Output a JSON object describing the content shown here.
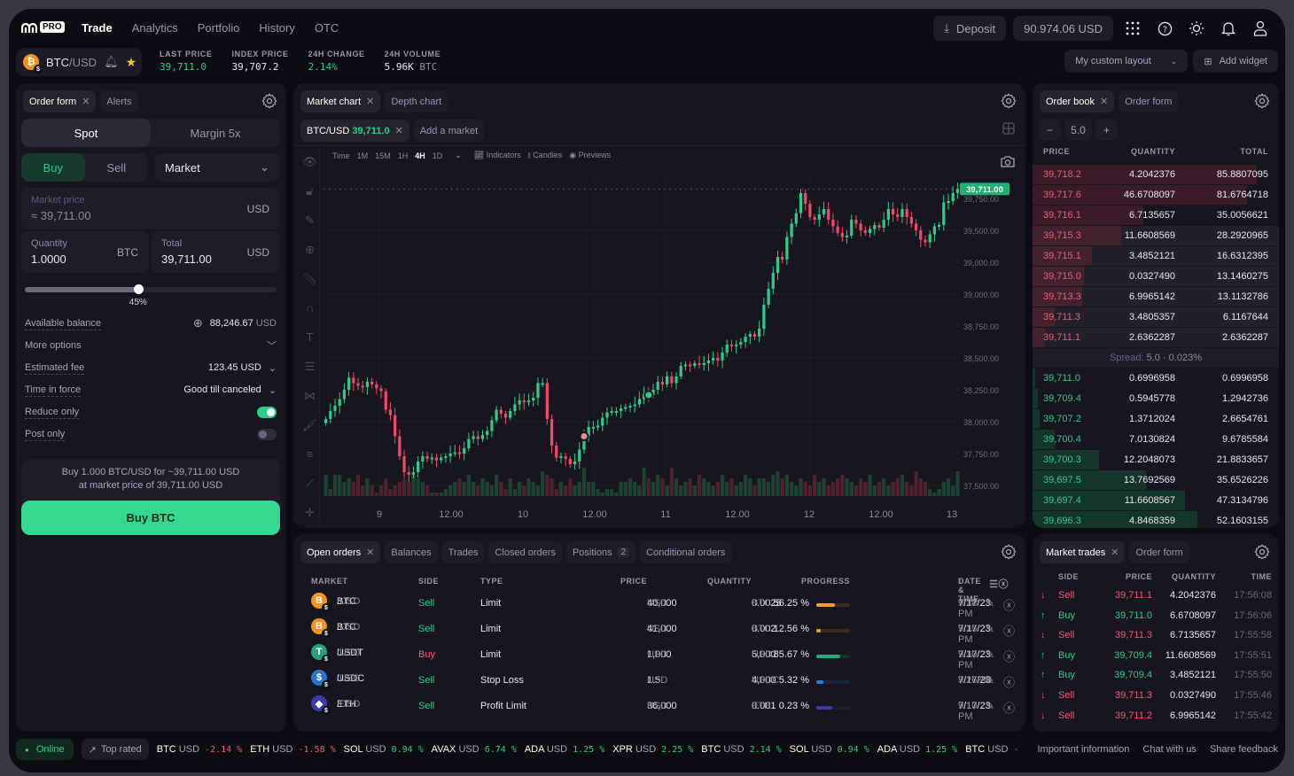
{
  "nav": {
    "logo_badge": "PRO",
    "links": [
      "Trade",
      "Analytics",
      "Portfolio",
      "History",
      "OTC"
    ],
    "active": "Trade",
    "deposit_label": "Deposit",
    "balance": "90.974.06 USD",
    "icons": [
      "apps-grid-icon",
      "help-icon",
      "theme-sun-icon",
      "bell-icon",
      "user-icon"
    ]
  },
  "ticker": {
    "pair_base": "BTC",
    "pair_quote": "/USD",
    "stats": [
      {
        "label": "LAST PRICE",
        "value": "39,711.0",
        "unit": "",
        "color": "#2ecc87"
      },
      {
        "label": "INDEX PRICE",
        "value": "39,707.2",
        "unit": "",
        "color": "#e8e6ee"
      },
      {
        "label": "24H CHANGE",
        "value": "2.14%",
        "unit": "",
        "color": "#2ecc87"
      },
      {
        "label": "24H VOLUME",
        "value": "5.96K",
        "unit": "BTC",
        "color": "#e8e6ee"
      }
    ],
    "layout_select": "My custom layout",
    "add_widget_label": "Add widget"
  },
  "order_form": {
    "tabs": [
      "Order form",
      "Alerts"
    ],
    "mode_tabs": [
      "Spot",
      "Margin 5x"
    ],
    "side_tabs": [
      "Buy",
      "Sell"
    ],
    "order_type": "Market",
    "market_price_label": "Market price",
    "market_price_value": "≈ 39,711.00",
    "market_price_unit": "USD",
    "quantity_label": "Quantity",
    "quantity_value": "1.0000",
    "quantity_unit": "BTC",
    "total_label": "Total",
    "total_value": "39,711.00",
    "total_unit": "USD",
    "slider_percent": 45,
    "slider_label": "45%",
    "available_balance_label": "Available balance",
    "available_balance_value": "88,246.67",
    "available_balance_unit": "USD",
    "more_options_label": "More options",
    "estimated_fee_label": "Estimated fee",
    "estimated_fee_value": "123.45 USD",
    "time_in_force_label": "Time in force",
    "time_in_force_value": "Good till canceled",
    "reduce_only_label": "Reduce only",
    "reduce_only_on": true,
    "post_only_label": "Post only",
    "post_only_on": false,
    "summary_line1": "Buy 1.000 BTC/USD for ~39,711.00 USD",
    "summary_line2": "at market price of 39,711.00 USD",
    "submit_label": "Buy BTC"
  },
  "chart_panel": {
    "tabs": [
      "Market chart",
      "Depth chart"
    ],
    "market_tab_pair": "BTC/USD",
    "market_tab_price": "39,711.0",
    "add_market_label": "Add a market",
    "time_label": "Time",
    "intervals": [
      "1M",
      "15M",
      "1H",
      "4H",
      "1D"
    ],
    "active_interval": "4H",
    "indicators_label": "Indicators",
    "candles_label": "Candles",
    "previews_label": "Previews",
    "tool_icons": [
      "eye-icon",
      "lock-icon",
      "pencil-lock-icon",
      "zoom-in-icon",
      "ruler-icon",
      "magnet-icon",
      "text-icon",
      "fib-icon",
      "pattern-icon",
      "brush-icon",
      "lines-icon",
      "trendline-icon",
      "crosshair-icon"
    ]
  },
  "chart_data": {
    "type": "candlestick",
    "title": "BTC/USD 4H",
    "y_tick_labels": [
      "39,750.00",
      "39,500.00",
      "39,000.00",
      "39,000.00",
      "38,750.00",
      "38,500.00",
      "38,250.00",
      "38,000.00",
      "37,750.00",
      "37,500.00"
    ],
    "x_tick_labels": [
      "9",
      "12.00",
      "10",
      "12.00",
      "11",
      "12.00",
      "12",
      "12.00",
      "13"
    ],
    "ylim": [
      37400,
      39800
    ],
    "last_price": 39711.0,
    "last_price_label": "39,711.00",
    "close_series": [
      37980,
      38040,
      38080,
      38130,
      38200,
      38290,
      38250,
      38230,
      38220,
      38260,
      38240,
      38210,
      38190,
      38050,
      38010,
      37850,
      37700,
      37580,
      37560,
      37580,
      37660,
      37700,
      37680,
      37690,
      37670,
      37690,
      37700,
      37720,
      37730,
      37720,
      37760,
      37830,
      37850,
      37830,
      37860,
      37890,
      37970,
      38050,
      38020,
      37990,
      38040,
      38090,
      38120,
      38110,
      38120,
      38140,
      38250,
      38250,
      37980,
      37780,
      37690,
      37700,
      37680,
      37640,
      37660,
      37750,
      37850,
      37920,
      37920,
      37930,
      37990,
      38030,
      38040,
      38040,
      38060,
      38070,
      38080,
      38090,
      38130,
      38170,
      38160,
      38200,
      38260,
      38240,
      38300,
      38250,
      38300,
      38380,
      38390,
      38380,
      38400,
      38390,
      38400,
      38420,
      38440,
      38420,
      38480,
      38540,
      38530,
      38540,
      38560,
      38600,
      38620,
      38600,
      38660,
      38840,
      38960,
      39080,
      39200,
      39180,
      39350,
      39450,
      39530,
      39680,
      39600,
      39500,
      39480,
      39520,
      39560,
      39480,
      39430,
      39380,
      39350,
      39360,
      39480,
      39450,
      39400,
      39380,
      39410,
      39440,
      39420,
      39480,
      39560,
      39520,
      39500,
      39560,
      39500,
      39450,
      39400,
      39330,
      39310,
      39370,
      39430,
      39440,
      39610,
      39620,
      39680,
      39711
    ],
    "volume_levels": [
      0.6,
      0.2,
      0.6,
      0.6,
      0.4,
      0.5,
      0.4,
      0.6,
      0.3,
      0.5,
      0.3,
      0.1,
      0.3,
      0.5,
      0.2,
      0.3,
      0.4,
      0.5,
      0.4,
      0.6,
      0.5,
      0.4,
      0.3,
      0.1,
      0.1,
      0.1,
      0.2,
      0.3,
      0.4,
      0.5,
      0.4,
      0.6,
      0.4,
      0.3,
      0.5,
      0.4,
      0.3,
      0.6,
      0.4,
      0.2,
      0.5,
      0.2,
      0.4,
      0.3,
      0.5,
      0.4,
      0.3,
      0.7,
      0.6,
      0.5,
      0.2,
      0.4,
      0.3,
      0.5,
      0.3,
      0.4,
      0.8,
      0.4,
      0.4,
      0.2,
      0.1,
      0.2,
      0.2,
      0.1,
      0.4,
      0.4,
      0.5,
      0.4,
      0.3,
      0.8,
      0.5,
      0.4,
      0.6,
      0.5,
      0.3,
      0.8,
      0.5,
      0.3,
      0.4,
      0.5,
      0.3,
      0.6,
      0.5,
      0.4,
      0.3,
      0.4,
      0.6,
      0.4,
      0.5,
      0.3,
      0.4,
      0.6,
      0.5,
      0.3,
      0.5,
      0.5,
      0.4,
      0.6,
      0.7,
      0.5,
      0.6,
      0.4,
      0.3,
      0.5,
      0.4,
      0.3,
      0.6,
      0.4,
      0.5,
      0.3,
      0.4,
      0.5,
      0.6,
      0.5,
      0.4,
      0.3,
      0.5,
      0.4,
      0.6,
      0.3,
      0.4,
      0.5,
      0.3,
      0.4,
      0.5,
      0.6,
      0.4,
      0.3,
      0.7,
      0.5,
      0.4,
      0.2,
      0.1,
      0.2,
      0.4,
      0.5,
      0.3,
      0.7
    ],
    "markers": [
      {
        "type": "sell",
        "index": 56,
        "color": "#f58a9a"
      },
      {
        "type": "buy",
        "index": 70,
        "color": "#2ecc87"
      }
    ]
  },
  "order_book": {
    "tabs": [
      "Order book",
      "Order form"
    ],
    "step_value": "5.0",
    "headers": [
      "PRICE",
      "QUANTITY",
      "TOTAL"
    ],
    "asks": [
      {
        "price": "39,718.2",
        "qty": "4.2042376",
        "total": "85.8807095",
        "depth": 0.91
      },
      {
        "price": "39,717.6",
        "qty": "46.6708097",
        "total": "81.6764718",
        "depth": 0.87
      },
      {
        "price": "39,716.1",
        "qty": "6.7135657",
        "total": "35.0056621",
        "depth": 0.45
      },
      {
        "price": "39,715.3",
        "qty": "11.6608569",
        "total": "28.2920965",
        "depth": 0.36
      },
      {
        "price": "39,715.1",
        "qty": "3.4852121",
        "total": "16.6312395",
        "depth": 0.24
      },
      {
        "price": "39,715.0",
        "qty": "0.0327490",
        "total": "13.1460275",
        "depth": 0.21
      },
      {
        "price": "39,713.3",
        "qty": "6.9965142",
        "total": "13.1132786",
        "depth": 0.2
      },
      {
        "price": "39,711.3",
        "qty": "3.4805357",
        "total": "6.1167644",
        "depth": 0.09
      },
      {
        "price": "39,711.1",
        "qty": "2.6362287",
        "total": "2.6362287",
        "depth": 0.05
      }
    ],
    "spread_label": "Spread:",
    "spread_value": "5.0 · 0.023%",
    "bids": [
      {
        "price": "39,711.0",
        "qty": "0.6996958",
        "total": "0.6996958",
        "depth": 0.01
      },
      {
        "price": "39,709.4",
        "qty": "0.5945778",
        "total": "1.2942736",
        "depth": 0.02
      },
      {
        "price": "39,707.2",
        "qty": "1.3712024",
        "total": "2.6654761",
        "depth": 0.03
      },
      {
        "price": "39,700.4",
        "qty": "7.0130824",
        "total": "9.6785584",
        "depth": 0.09
      },
      {
        "price": "39,700.3",
        "qty": "12.2048073",
        "total": "21.8833657",
        "depth": 0.27
      },
      {
        "price": "39,697.5",
        "qty": "13.7692569",
        "total": "35.6526226",
        "depth": 0.46
      },
      {
        "price": "39,697.4",
        "qty": "11.6608567",
        "total": "47.3134796",
        "depth": 0.62
      },
      {
        "price": "39,696.3",
        "qty": "4.8468359",
        "total": "52.1603155",
        "depth": 0.67
      }
    ]
  },
  "orders": {
    "tabs": [
      {
        "label": "Open orders",
        "closable": true,
        "active": true
      },
      {
        "label": "Balances"
      },
      {
        "label": "Trades"
      },
      {
        "label": "Closed orders"
      },
      {
        "label": "Positions",
        "badge": "2"
      },
      {
        "label": "Conditional orders"
      }
    ],
    "headers": [
      "MARKET",
      "SIDE",
      "TYPE",
      "PRICE",
      "QUANTITY",
      "PROGRESS",
      "DATE & TIME"
    ],
    "rows": [
      {
        "coin": "B",
        "coin_color": "#f7931a",
        "base": "BTC",
        "quote": "/USD",
        "side": "Sell",
        "type": "Limit",
        "price": "40,000",
        "price_unit": "USD",
        "qty": "0.0025",
        "qty_unit": "BTC",
        "progress_label": "56.25 %",
        "progress": 56.25,
        "bar_color": "#f7a21a",
        "track_color": "#3d2c17",
        "date": "7/17/23",
        "time": "9:38 PM"
      },
      {
        "coin": "B",
        "coin_color": "#f7931a",
        "base": "BTC",
        "quote": "/USD",
        "side": "Sell",
        "type": "Limit",
        "price": "41,000",
        "price_unit": "USD",
        "qty": "0.002",
        "qty_unit": "BTC",
        "progress_label": "12.56 %",
        "progress": 12.56,
        "bar_color": "#f7a21a",
        "track_color": "#3d2c17",
        "date": "7/17/23",
        "time": "9:35 PM"
      },
      {
        "coin": "T",
        "coin_color": "#26a17b",
        "base": "USDT",
        "quote": "/USD",
        "side": "Buy",
        "type": "Limit",
        "price": "1,000",
        "price_unit": "USD",
        "qty": "5,000",
        "qty_unit": "USDT",
        "progress_label": "85.67 %",
        "progress": 70,
        "bar_color": "#2ba77f",
        "track_color": "#17302a",
        "date": "7/17/23",
        "time": "9:30 PM"
      },
      {
        "coin": "$",
        "coin_color": "#2775ca",
        "base": "USDC",
        "quote": "/USD",
        "side": "Sell",
        "type": "Stop Loss",
        "price": "1.5",
        "price_unit": "USD",
        "qty": "4,000",
        "qty_unit": "USDC",
        "progress_label": "5.32 %",
        "progress": 22,
        "bar_color": "#2f7fd8",
        "track_color": "#17263b",
        "date": "7/17/23",
        "time": "9:26PM"
      },
      {
        "coin": "◆",
        "coin_color": "#3c3ca8",
        "base": "ETH",
        "quote": "/USD",
        "side": "Sell",
        "type": "Profit Limit",
        "price": "36,000",
        "price_unit": "USD",
        "qty": "0.001",
        "qty_unit": "ETH",
        "progress_label": "0.23 %",
        "progress": 47,
        "bar_color": "#3a3ab0",
        "track_color": "#1d1d3a",
        "date": "7/17/23",
        "time": "9:10 PM"
      }
    ]
  },
  "market_trades": {
    "tabs": [
      "Market trades",
      "Order form"
    ],
    "headers": [
      "SIDE",
      "PRICE",
      "QUANTITY",
      "TIME"
    ],
    "rows": [
      {
        "side": "Sell",
        "price": "39,711.1",
        "qty": "4.2042376",
        "time": "17:56:08"
      },
      {
        "side": "Buy",
        "price": "39,711.0",
        "qty": "6.6708097",
        "time": "17:56:06"
      },
      {
        "side": "Sell",
        "price": "39,711.3",
        "qty": "6.7135657",
        "time": "17:55:58"
      },
      {
        "side": "Buy",
        "price": "39,709.4",
        "qty": "11.6608569",
        "time": "17:55:51"
      },
      {
        "side": "Buy",
        "price": "39,709.4",
        "qty": "3.4852121",
        "time": "17:55:50"
      },
      {
        "side": "Sell",
        "price": "39,711.3",
        "qty": "0.0327490",
        "time": "17:55:46"
      },
      {
        "side": "Sell",
        "price": "39,711.2",
        "qty": "6.9965142",
        "time": "17:55:42"
      }
    ]
  },
  "footer": {
    "status": "Online",
    "top_rated": "Top rated",
    "tickers": [
      {
        "base": "BTC",
        "quote": "USD",
        "change": "-2.14 %",
        "dir": "down"
      },
      {
        "base": "ETH",
        "quote": "USD",
        "change": "-1.58 %",
        "dir": "down"
      },
      {
        "base": "SOL",
        "quote": "USD",
        "change": "0.94 %",
        "dir": "up"
      },
      {
        "base": "AVAX",
        "quote": "USD",
        "change": "6.74 %",
        "dir": "up"
      },
      {
        "base": "ADA",
        "quote": "USD",
        "change": "1.25 %",
        "dir": "up"
      },
      {
        "base": "XPR",
        "quote": "USD",
        "change": "2.25 %",
        "dir": "up"
      },
      {
        "base": "BTC",
        "quote": "USD",
        "change": "2.14 %",
        "dir": "up"
      },
      {
        "base": "SOL",
        "quote": "USD",
        "change": "0.94 %",
        "dir": "up"
      },
      {
        "base": "ADA",
        "quote": "USD",
        "change": "1.25 %",
        "dir": "up"
      },
      {
        "base": "BTC",
        "quote": "USD",
        "change": "-",
        "dir": "down"
      }
    ],
    "links": [
      "Important information",
      "Chat with us",
      "Share feedback"
    ]
  },
  "colors": {
    "up": "#2ecc87",
    "down": "#ef5b73",
    "panel": "#17151f",
    "accent": "#33d98e"
  }
}
